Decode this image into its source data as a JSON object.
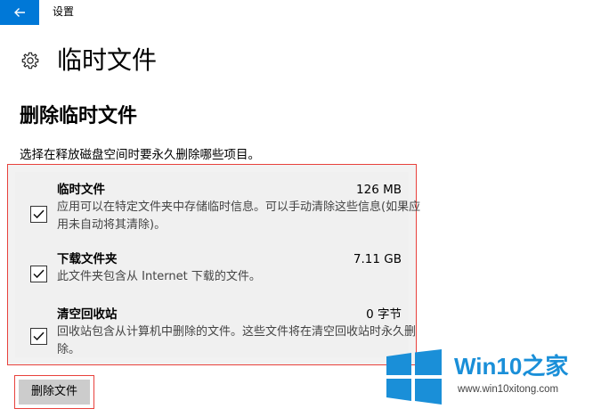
{
  "window": {
    "title": "设置"
  },
  "header": {
    "title": "临时文件"
  },
  "section": {
    "title": "删除临时文件",
    "description": "选择在释放磁盘空间时要永久删除哪些项目。"
  },
  "items": [
    {
      "name": "临时文件",
      "size": "126 MB",
      "description": "应用可以在特定文件夹中存储临时信息。可以手动清除这些信息(如果应用未自动将其清除)。",
      "checked": true
    },
    {
      "name": "下载文件夹",
      "size": "7.11 GB",
      "description": "此文件夹包含从 Internet 下载的文件。",
      "checked": true
    },
    {
      "name": "清空回收站",
      "size": "0 字节",
      "description": "回收站包含从计算机中删除的文件。这些文件将在清空回收站时永久删除。",
      "checked": true
    }
  ],
  "actions": {
    "delete_label": "删除文件"
  },
  "watermark": {
    "brand": "Win10",
    "brand_suffix": "之家",
    "url": "www.win10xitong.com"
  },
  "colors": {
    "accent": "#0078d7",
    "highlight": "#e8413c",
    "brand": "#1a8fd8"
  }
}
